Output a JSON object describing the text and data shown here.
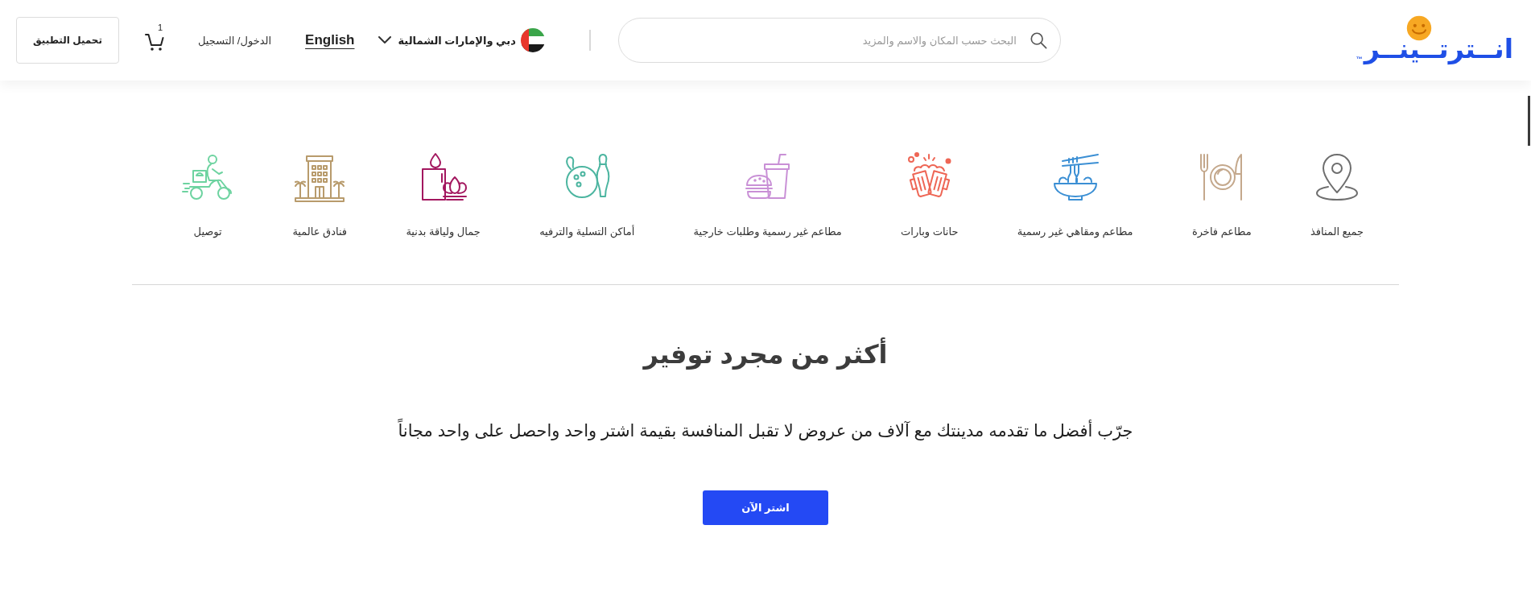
{
  "header": {
    "logo": {
      "text": "انــترتــينــر",
      "trademark": "™"
    },
    "search": {
      "placeholder": "البحث حسب المكان والاسم والمزيد"
    },
    "location": {
      "label": "دبي والإمارات الشمالية"
    },
    "language_link": "English",
    "login_link": "الدخول/ التسجيل",
    "cart": {
      "count": "1"
    },
    "app_button": "تحميل التطبيق"
  },
  "categories": [
    {
      "label": "جميع المنافذ",
      "kind": "pin",
      "color": "#6e6e6e"
    },
    {
      "label": "مطاعم فاخرة",
      "kind": "plate",
      "color": "#c4a88c"
    },
    {
      "label": "مطاعم ومقاهي غير رسمية",
      "kind": "noodles",
      "color": "#3b8fd4"
    },
    {
      "label": "حانات وبارات",
      "kind": "mugs",
      "color": "#ee6655"
    },
    {
      "label": "مطاعم غير رسمية وطلبات خارجية",
      "kind": "burger",
      "color": "#c990d6"
    },
    {
      "label": "أماكن التسلية والترفيه",
      "kind": "bowling",
      "color": "#4cb5a0"
    },
    {
      "label": "جمال ولياقة بدنية",
      "kind": "candle",
      "color": "#a3175f"
    },
    {
      "label": "فنادق عالمية",
      "kind": "hotel",
      "color": "#b89b6c"
    },
    {
      "label": "توصيل",
      "kind": "scooter",
      "color": "#6dd3a0"
    }
  ],
  "hero": {
    "title": "أكثر من مجرد توفير",
    "text": "جرّب أفضل ما تقدمه مدينتك مع آلاف من عروض لا تقبل المنافسة بقيمة اشتر واحد واحصل على واحد مجاناً",
    "button": "اشتر الآن"
  }
}
